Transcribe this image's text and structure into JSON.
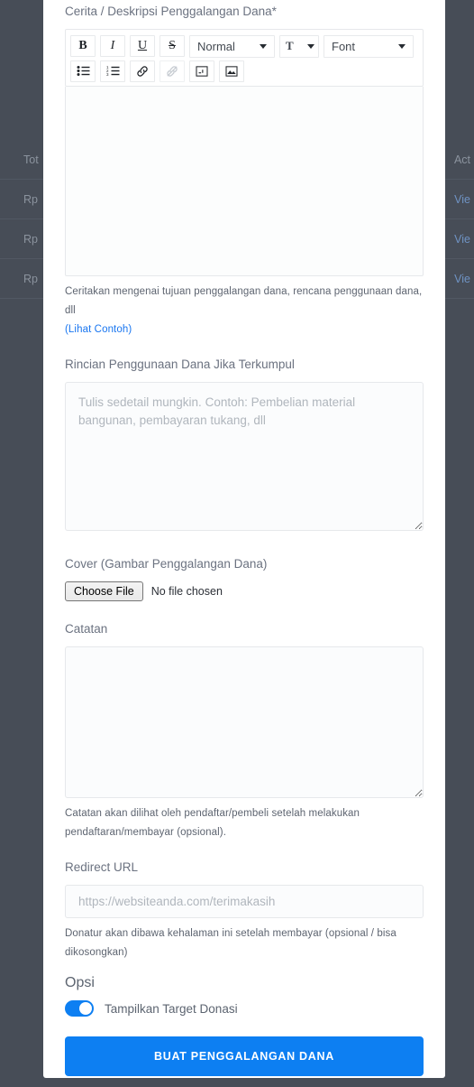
{
  "background": {
    "table_header": {
      "left": "Tot",
      "right": "Act"
    },
    "rows": [
      {
        "left": "Rp",
        "right": "Vie"
      },
      {
        "left": "Rp",
        "right": "Vie"
      },
      {
        "left": "Rp",
        "right": "Vie"
      }
    ]
  },
  "form": {
    "cerita": {
      "label": "Cerita / Deskripsi Penggalangan Dana*",
      "toolbar": {
        "bold": "B",
        "italic": "I",
        "underline": "U",
        "strike": "S",
        "header_select": "Normal",
        "size_select": "T",
        "font_select": "Font",
        "bullet_list": "bullet-list",
        "ordered_list": "ordered-list",
        "link": "link",
        "unlink": "unlink",
        "video": "video",
        "image": "image"
      },
      "content": "",
      "helper": "Ceritakan mengenai tujuan penggalangan dana, rencana penggunaan dana, dll",
      "helper_link": "(Lihat Contoh)"
    },
    "rincian": {
      "label": "Rincian Penggunaan Dana Jika Terkumpul",
      "value": "",
      "placeholder": "Tulis sedetail mungkin. Contoh: Pembelian material bangunan, pembayaran tukang, dll"
    },
    "cover": {
      "label": "Cover (Gambar Penggalangan Dana)",
      "button": "Choose File",
      "file_status": "No file chosen"
    },
    "catatan": {
      "label": "Catatan",
      "value": "",
      "placeholder": "",
      "helper": "Catatan akan dilihat oleh pendaftar/pembeli setelah melakukan pendaftaran/membayar (opsional)."
    },
    "redirect": {
      "label": "Redirect URL",
      "value": "",
      "placeholder": "https://websiteanda.com/terimakasih",
      "helper": "Donatur akan dibawa kehalaman ini setelah membayar (opsional / bisa dikosongkan)"
    },
    "opsi": {
      "title": "Opsi",
      "toggle_label": "Tampilkan Target Donasi",
      "toggle_on": true
    },
    "submit": {
      "label": "BUAT PENGGALANGAN DANA"
    }
  },
  "colors": {
    "accent": "#0d7ff2",
    "link": "#1976f0",
    "backdrop": "#474d57",
    "modal_bg": "#ffffff",
    "border": "#e6e8eb"
  }
}
